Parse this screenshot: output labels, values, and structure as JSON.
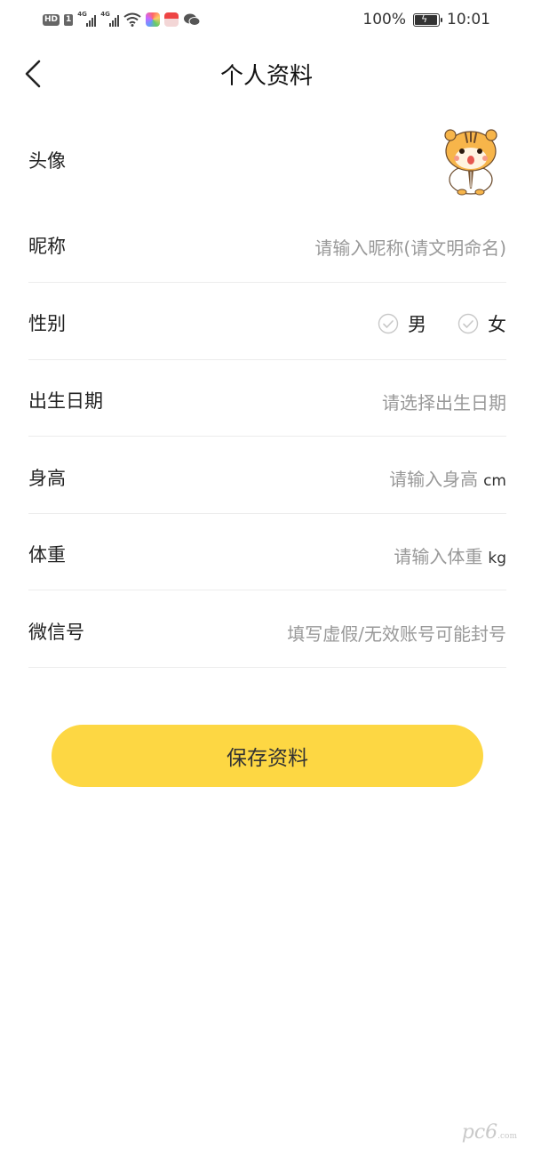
{
  "status_bar": {
    "hd_label": "HD",
    "sim_label": "1",
    "network_1": "4G",
    "network_2": "4G",
    "battery_text": "100%",
    "battery_level": 1.0,
    "time": "10:01",
    "icons": [
      "hd-icon",
      "signal-icon",
      "signal-icon",
      "wifi-icon",
      "app-icon",
      "app-icon",
      "wechat-icon",
      "battery-icon"
    ]
  },
  "nav": {
    "back_icon": "chevron-left-icon",
    "title": "个人资料"
  },
  "form": {
    "avatar": {
      "label": "头像",
      "icon": "hamster-avatar"
    },
    "nickname": {
      "label": "昵称",
      "placeholder": "请输入昵称(请文明命名)"
    },
    "gender": {
      "label": "性别",
      "options": [
        {
          "label": "男",
          "checked": false
        },
        {
          "label": "女",
          "checked": false
        }
      ]
    },
    "birthday": {
      "label": "出生日期",
      "placeholder": "请选择出生日期"
    },
    "height": {
      "label": "身高",
      "placeholder": "请输入身高",
      "unit": "cm"
    },
    "weight": {
      "label": "体重",
      "placeholder": "请输入体重",
      "unit": "kg"
    },
    "wechat": {
      "label": "微信号",
      "placeholder": "填写虚假/无效账号可能封号"
    }
  },
  "save_button": {
    "label": "保存资料"
  },
  "colors": {
    "accent": "#fdd743",
    "divider": "#ececec",
    "placeholder": "#999999",
    "text": "#222222"
  },
  "watermark": {
    "text": "pc6",
    "suffix": ".com"
  }
}
